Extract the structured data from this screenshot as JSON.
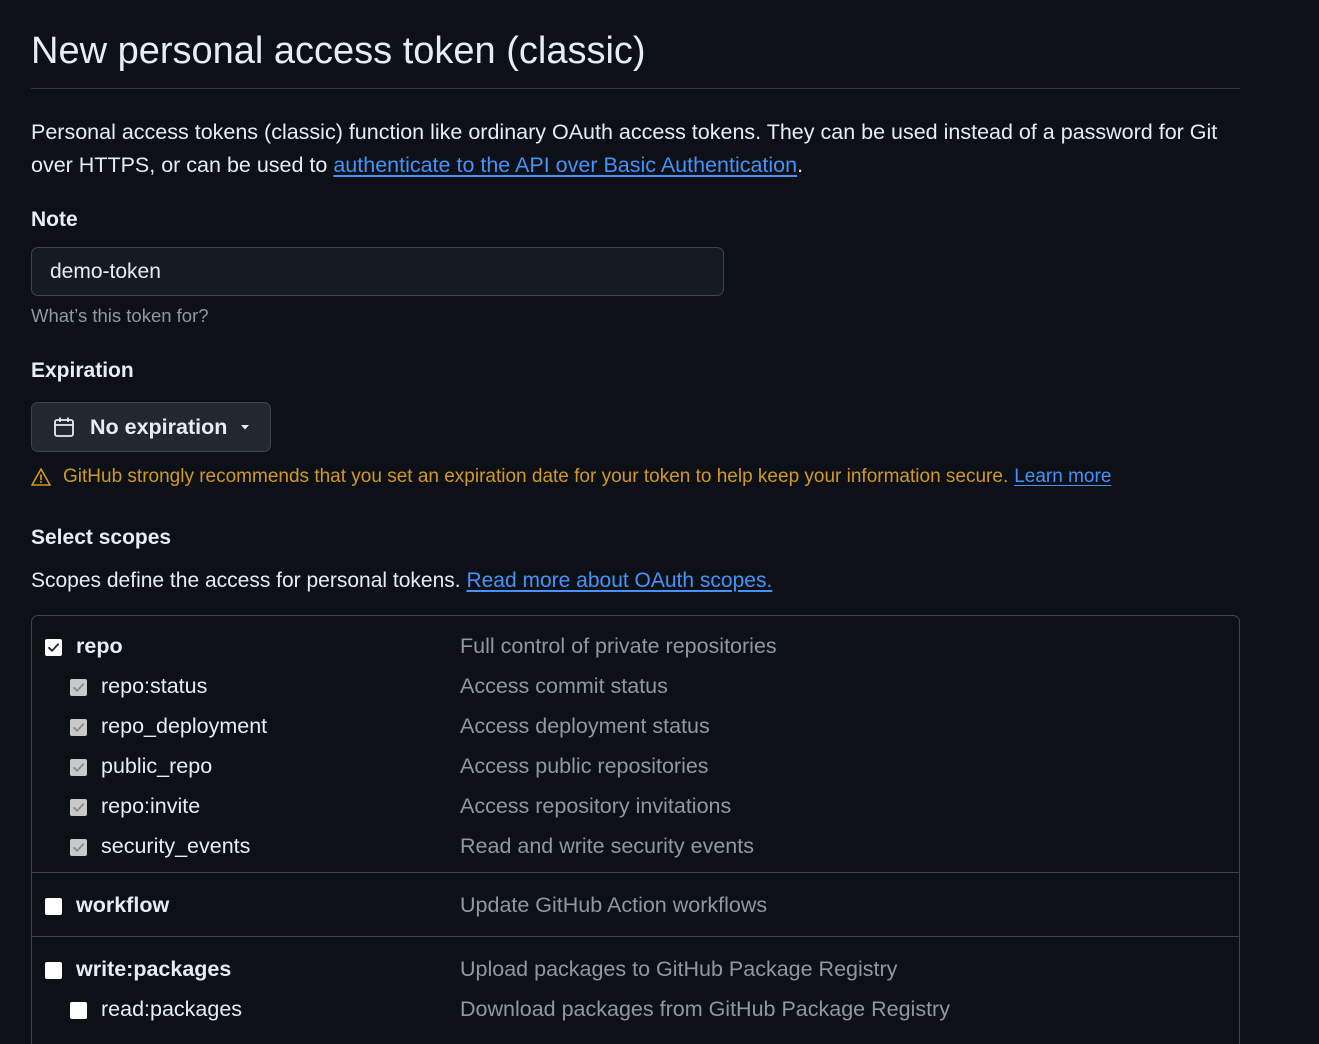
{
  "header": {
    "title": "New personal access token (classic)"
  },
  "intro": {
    "text_before": "Personal access tokens (classic) function like ordinary OAuth access tokens. They can be used instead of a password for Git over HTTPS, or can be used to ",
    "link_text": "authenticate to the API over Basic Authentication",
    "text_after": "."
  },
  "note": {
    "label": "Note",
    "value": "demo-token",
    "help": "What’s this token for?"
  },
  "expiration": {
    "label": "Expiration",
    "selected": "No expiration",
    "icon": "calendar-icon",
    "warning_text": "GitHub strongly recommends that you set an expiration date for your token to help keep your information secure.",
    "warning_link": "Learn more",
    "warning_color": "#d29922"
  },
  "scopes": {
    "label": "Select scopes",
    "desc_text": "Scopes define the access for personal tokens.",
    "desc_link": "Read more about OAuth scopes.",
    "groups": [
      {
        "name": "repo",
        "description": "Full control of private repositories",
        "checked": true,
        "children": [
          {
            "name": "repo:status",
            "description": "Access commit status",
            "checked": true
          },
          {
            "name": "repo_deployment",
            "description": "Access deployment status",
            "checked": true
          },
          {
            "name": "public_repo",
            "description": "Access public repositories",
            "checked": true
          },
          {
            "name": "repo:invite",
            "description": "Access repository invitations",
            "checked": true
          },
          {
            "name": "security_events",
            "description": "Read and write security events",
            "checked": true
          }
        ]
      },
      {
        "name": "workflow",
        "description": "Update GitHub Action workflows",
        "checked": false,
        "children": []
      },
      {
        "name": "write:packages",
        "description": "Upload packages to GitHub Package Registry",
        "checked": false,
        "children": [
          {
            "name": "read:packages",
            "description": "Download packages from GitHub Package Registry",
            "checked": false
          }
        ]
      }
    ]
  },
  "colors": {
    "background": "#0d1117",
    "link": "#4493f8",
    "muted": "#9198a1",
    "border": "#3d444d"
  }
}
